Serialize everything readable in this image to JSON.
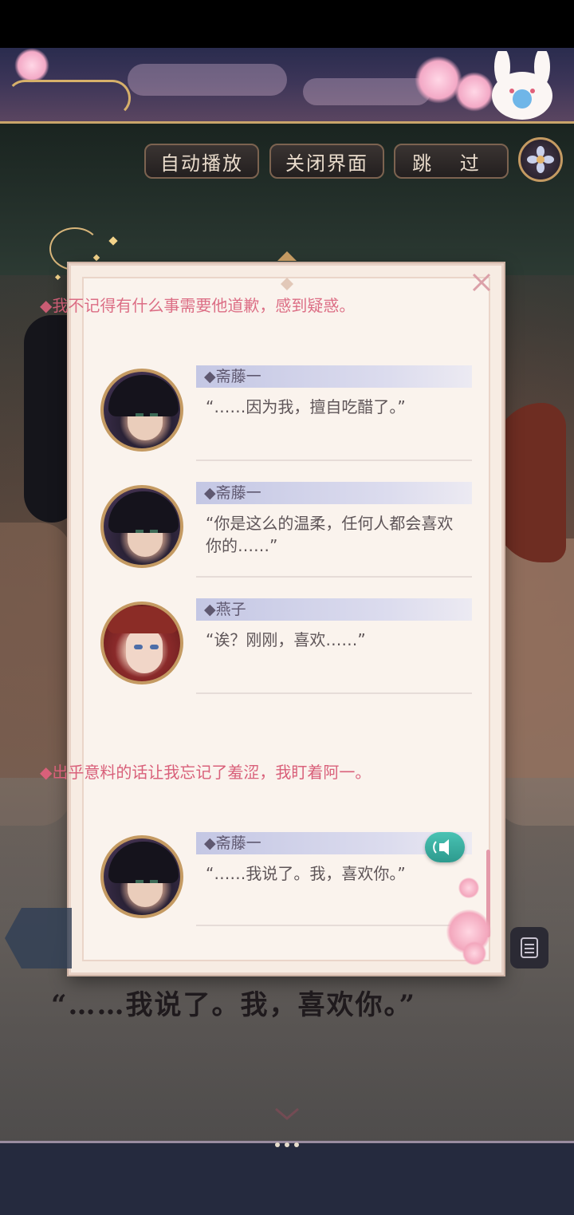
{
  "controls": {
    "auto_play": "自动播放",
    "close_ui": "关闭界面",
    "skip": "跳 过"
  },
  "log": {
    "narration_top": "◆我不记得有什么事需要他道歉，感到疑惑。",
    "entries": [
      {
        "name": "◆斋藤一",
        "text": "“……因为我，擅自吃醋了。”"
      },
      {
        "name": "◆斋藤一",
        "text": "“你是这么的温柔，任何人都会喜欢你的……”"
      },
      {
        "name": "◆燕子",
        "text": "“诶？刚刚，喜欢……”"
      }
    ],
    "narration_mid": "◆出乎意料的话让我忘记了羞涩，我盯着阿一。",
    "last_entry": {
      "name": "◆斋藤一",
      "text": "“……我说了。我，喜欢你。”"
    }
  },
  "dialogue": {
    "text": "“……我说了。我，喜欢你。”"
  },
  "icons": {
    "close": "close-icon",
    "voice": "speaker-icon",
    "menu": "flower-menu-icon",
    "log": "log-icon"
  },
  "colors": {
    "narration": "#d9607a",
    "name_bar": "#c4c7e4",
    "button_border": "#7c6350",
    "voice": "#3db0a2"
  }
}
